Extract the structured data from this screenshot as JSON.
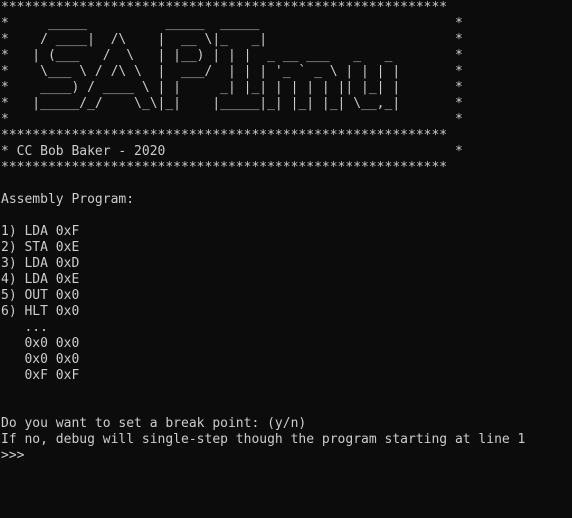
{
  "console": {
    "banner": [
      "*********************************************************",
      "*     _____          _____  _____                         *",
      "*    / ____|  /\\    |  __ \\|_   _|                        *",
      "*   | (___   /  \\   | |__) | | |  _ __ ___   _   _        *",
      "*    \\___ \\ / /\\ \\  |  ___/  | | | '_ ` _ \\ | | | |       *",
      "*    ____) / ____ \\ | |     _| |_| | | | | || |_| |       *",
      "*   |_____/_/    \\_\\|_|    |_____|_| |_| |_| \\__,_|       *",
      "*                                                         *",
      "*********************************************************",
      "* CC Bob Baker - 2020                                     *",
      "*********************************************************"
    ],
    "section_title": "Assembly Program:",
    "program": [
      "1) LDA 0xF",
      "2) STA 0xE",
      "3) LDA 0xD",
      "4) LDA 0xE",
      "5) OUT 0x0",
      "6) HLT 0x0"
    ],
    "memory": [
      "   ...",
      "   0x0 0x0",
      "   0x0 0x0",
      "   0xF 0xF"
    ],
    "prompt_question": "Do you want to set a break point: (y/n)",
    "prompt_hint": "If no, debug will single-step though the program starting at line 1",
    "prompt_symbol": ">>>"
  }
}
